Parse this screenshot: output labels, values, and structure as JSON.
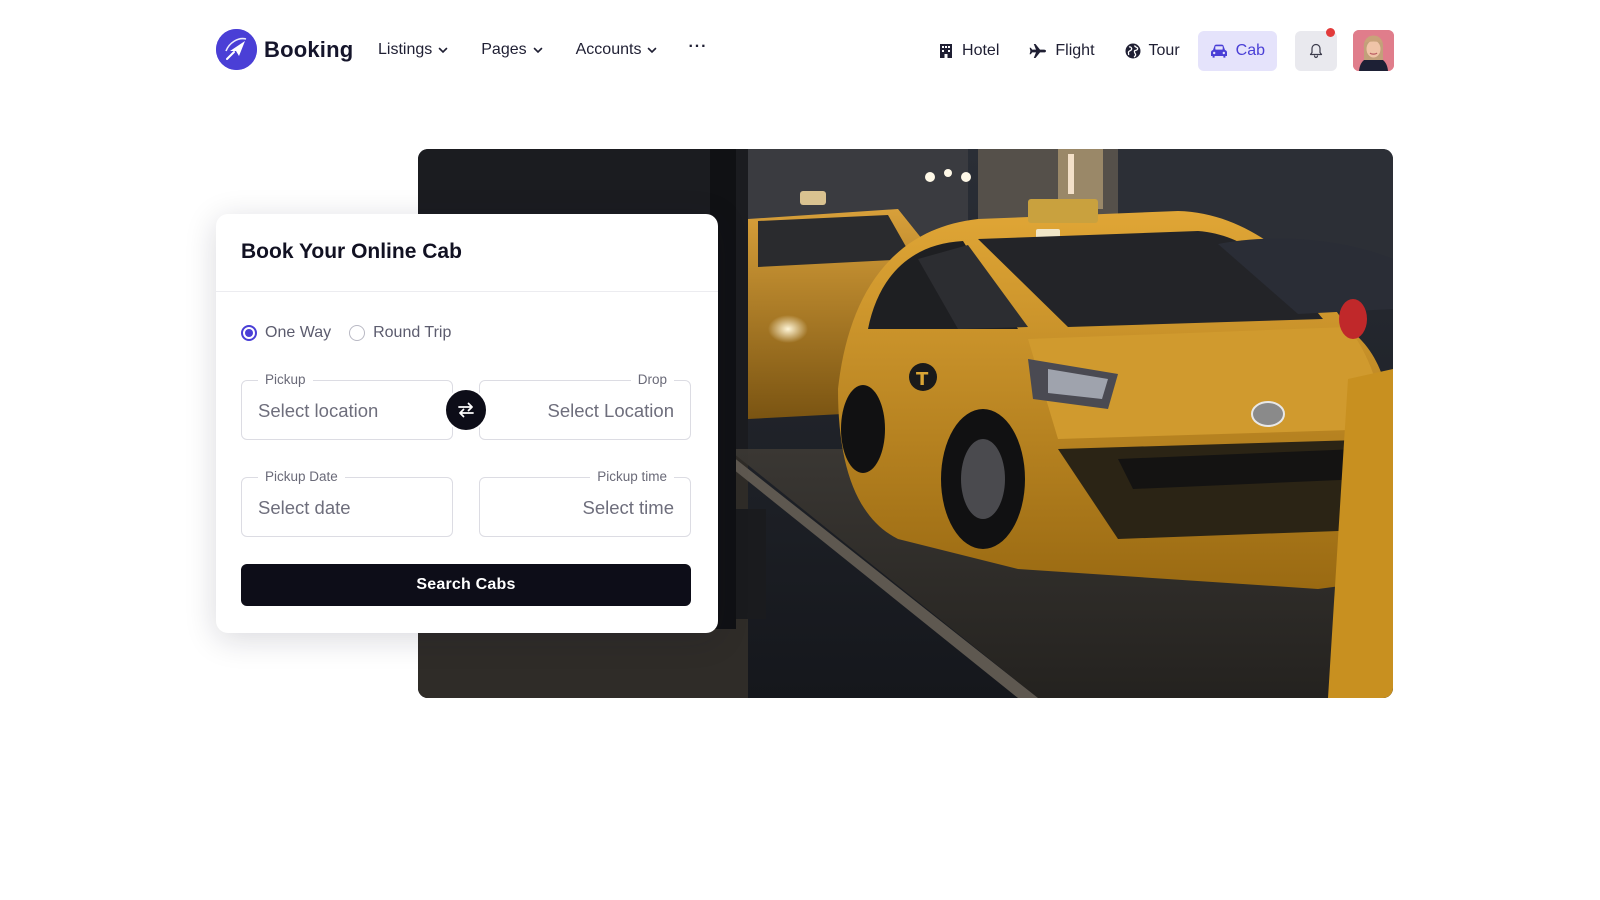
{
  "brand": {
    "name": "Booking",
    "accent": "#4a3fd6"
  },
  "nav": {
    "menu": [
      {
        "label": "Listings",
        "has_dropdown": true
      },
      {
        "label": "Pages",
        "has_dropdown": true
      },
      {
        "label": "Accounts",
        "has_dropdown": true
      }
    ],
    "more_label": "···",
    "categories": [
      {
        "label": "Hotel",
        "icon": "building-icon",
        "active": false
      },
      {
        "label": "Flight",
        "icon": "airplane-icon",
        "active": false
      },
      {
        "label": "Tour",
        "icon": "globe-icon",
        "active": false
      },
      {
        "label": "Cab",
        "icon": "car-icon",
        "active": true
      }
    ],
    "notification_icon": "bell-icon",
    "has_unread_notification": true
  },
  "booking": {
    "title": "Book Your Online Cab",
    "trip_types": [
      {
        "label": "One Way",
        "selected": true
      },
      {
        "label": "Round Trip",
        "selected": false
      }
    ],
    "pickup": {
      "label": "Pickup",
      "placeholder": "Select location"
    },
    "drop": {
      "label": "Drop",
      "placeholder": "Select Location"
    },
    "pickup_date": {
      "label": "Pickup Date",
      "placeholder": "Select date"
    },
    "pickup_time": {
      "label": "Pickup time",
      "placeholder": "Select time"
    },
    "swap_icon": "swap-arrows-icon",
    "submit_label": "Search Cabs"
  },
  "hero": {
    "image": "yellow taxi cabs on a city street at night"
  },
  "colors": {
    "accent": "#4a3fd6",
    "active_tab_bg": "#e5e3fb",
    "dark_button": "#0d0d18",
    "notification_dot": "#e23b3b"
  }
}
